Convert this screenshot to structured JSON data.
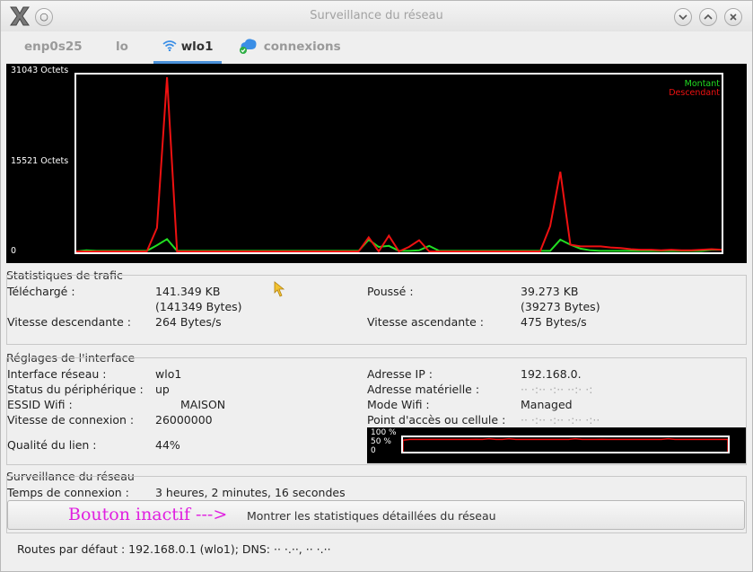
{
  "window": {
    "title": "Surveillance du réseau"
  },
  "tabs": [
    {
      "label": "enp0s25"
    },
    {
      "label": "lo"
    },
    {
      "label": "wlo1"
    },
    {
      "label": "connexions"
    }
  ],
  "graph": {
    "y_max_label": "31043 Octets",
    "y_mid_label": "15521 Octets",
    "y_min_label": "0",
    "legend_up": "Montant",
    "legend_down": "Descendant",
    "color_up": "#22dd22",
    "color_down": "#ee1111"
  },
  "chart_data": {
    "type": "line",
    "ylim": [
      0,
      31043
    ],
    "series": [
      {
        "name": "Descendant",
        "color": "#ee1111",
        "values": [
          0,
          0,
          0,
          0,
          0,
          0,
          0,
          0,
          4200,
          31043,
          0,
          0,
          0,
          0,
          0,
          0,
          0,
          0,
          0,
          0,
          0,
          0,
          0,
          0,
          0,
          0,
          0,
          0,
          0,
          2500,
          0,
          2800,
          0,
          800,
          2000,
          0,
          0,
          0,
          0,
          0,
          0,
          0,
          0,
          0,
          0,
          0,
          0,
          4500,
          14200,
          1200,
          900,
          900,
          900,
          700,
          600,
          400,
          300,
          300,
          200,
          300,
          200,
          200,
          300,
          400,
          300
        ]
      },
      {
        "name": "Montant",
        "color": "#22dd22",
        "values": [
          0,
          200,
          100,
          100,
          100,
          100,
          100,
          100,
          1100,
          2200,
          100,
          100,
          100,
          100,
          100,
          100,
          100,
          100,
          100,
          100,
          100,
          100,
          100,
          100,
          100,
          100,
          100,
          100,
          100,
          2100,
          800,
          1000,
          100,
          100,
          200,
          1000,
          100,
          100,
          100,
          100,
          100,
          100,
          100,
          100,
          100,
          100,
          100,
          100,
          2100,
          1200,
          500,
          200,
          100,
          100,
          100,
          100,
          100,
          100,
          100,
          100,
          100,
          100,
          100,
          300,
          300
        ]
      }
    ]
  },
  "trafic": {
    "title": "Statistiques de trafic",
    "telecharge_label": "Téléchargé :",
    "telecharge_value": "141.349 KB",
    "telecharge_bytes": "(141349 Bytes)",
    "pousse_label": "Poussé :",
    "pousse_value": "39.273 KB",
    "pousse_bytes": "(39273 Bytes)",
    "vdesc_label": "Vitesse descendante :",
    "vdesc_value": "264 Bytes/s",
    "vasc_label": "Vitesse ascendante :",
    "vasc_value": "475 Bytes/s"
  },
  "interface": {
    "title": "Réglages de l'interface",
    "iface_label": "Interface réseau :",
    "iface_value": "wlo1",
    "status_label": "Status du périphérique :",
    "status_value": "up",
    "essid_label": "ESSID Wifi :",
    "essid_value": "MAISON",
    "speed_label": "Vitesse de connexion :",
    "speed_value": "26000000",
    "quality_label": "Qualité du lien :",
    "quality_value": "44%",
    "ip_label": "Adresse IP :",
    "ip_value": "192.168.0.",
    "mac_label": "Adresse matérielle :",
    "mac_value": "·· ·:·· ·:·· ··:· ·:",
    "mode_label": "Mode Wifi :",
    "mode_value": "Managed",
    "ap_label": "Point d'accès ou cellule :",
    "ap_value": "·· ·:·· ·:·· ·:·· ·:··",
    "mini_100": "100 %",
    "mini_50": "50 %",
    "mini_0": "0",
    "quality_series": [
      0.8,
      0.85,
      0.85,
      0.85,
      0.85,
      0.85,
      0.85,
      0.85,
      0.85,
      0.85,
      0.85,
      0.86,
      0.85,
      0.9,
      0.85,
      0.85,
      0.9,
      0.85,
      0.85,
      0.85,
      0.85,
      0.85,
      0.85,
      0.85,
      0.85,
      0.85,
      0.9,
      0.85,
      0.85,
      0.85,
      0.86,
      0.85,
      0.85,
      0.85,
      0.85,
      0.85,
      0.85,
      0.85,
      0.85,
      0.85,
      0.9,
      0.85,
      0.85,
      0.85,
      0.85,
      0.85,
      0.85,
      0.85,
      0.85,
      0.85
    ]
  },
  "surveillance": {
    "title": "Surveillance du réseau",
    "temps_label": "Temps de connexion :",
    "temps_value": "3 heures, 2 minutes, 16 secondes",
    "annotation": "Bouton inactif --->",
    "button_label": "Montrer les statistiques détaillées du réseau"
  },
  "statusbar": {
    "text": "Routes par défaut : 192.168.0.1 (wlo1); DNS: ·· ·.··, ·· ·.··"
  }
}
